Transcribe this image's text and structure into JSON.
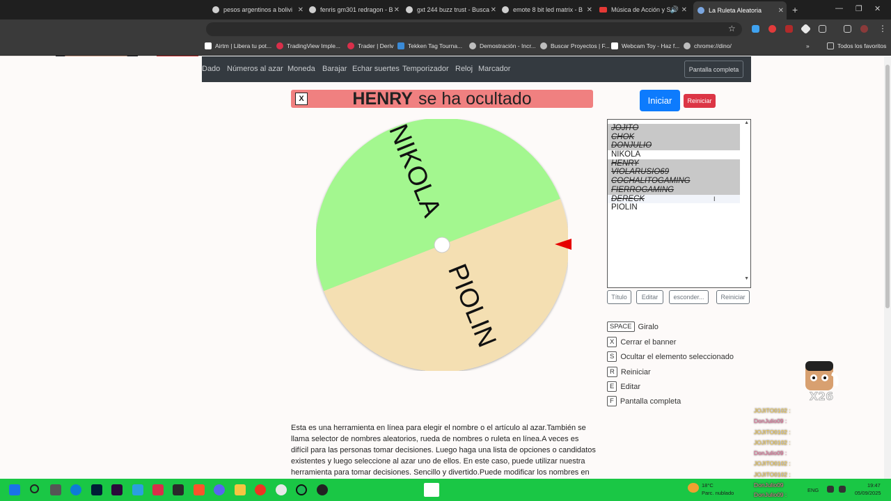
{
  "browser": {
    "tabs": [
      {
        "title": "pesos argentinos a bolivi"
      },
      {
        "title": "fenris gm301 redragon - B"
      },
      {
        "title": "gxt 244 buzz trust - Busca"
      },
      {
        "title": "emote 8 bit led matrix - B"
      },
      {
        "title": "Música de Acción y S"
      },
      {
        "title": "La Ruleta Aleatoria"
      }
    ],
    "new_tab": "+",
    "bookmarks": [
      "Airtm | Libera tu pot...",
      "TradingView Imple...",
      "Trader | Deriv",
      "Tekken Tag Tourna...",
      "Demostración - Incr...",
      "Buscar Proyectos | F...",
      "Webcam Toy - Haz f...",
      "chrome://dino/"
    ],
    "all_bookmarks": "Todos los favoritos"
  },
  "nav": {
    "links": [
      "Dado",
      "Números al azar",
      "Moneda",
      "Barajar",
      "Echar suertes",
      "Temporizador",
      "Reloj",
      "Marcador"
    ],
    "fullscreen": "Pantalla completa"
  },
  "banner": {
    "close": "X",
    "name": "HENRY",
    "message": "se ha ocultado"
  },
  "controls": {
    "start": "Iniciar",
    "reset": "Reiniciar"
  },
  "wheel": {
    "segments": [
      {
        "label": "NIKOLA",
        "color": "#a3f78f"
      },
      {
        "label": "PIOLIN",
        "color": "#f4dfb2"
      }
    ],
    "pointer_color": "#e60000"
  },
  "names_list": [
    {
      "text": "JOJITO",
      "state": "hidden"
    },
    {
      "text": "CHOK",
      "state": "hidden"
    },
    {
      "text": "DONJULIO",
      "state": "hidden"
    },
    {
      "text": "NIKOLA",
      "state": "visible"
    },
    {
      "text": "HENRY",
      "state": "hidden"
    },
    {
      "text": "VIOLARUSIO69",
      "state": "hidden"
    },
    {
      "text": "COCHALITOGAMING",
      "state": "hidden"
    },
    {
      "text": "FIERROGAMING",
      "state": "hidden"
    },
    {
      "text": "DERECK",
      "state": "hover"
    },
    {
      "text": "PIOLIN",
      "state": "visible"
    }
  ],
  "list_buttons": {
    "title": "Título",
    "edit": "Editar",
    "hide": "esconder...",
    "reset": "Reiniciar"
  },
  "shortcuts": [
    {
      "key": "SPACE",
      "label": "Giralo"
    },
    {
      "key": "X",
      "label": "Cerrar el banner"
    },
    {
      "key": "S",
      "label": "Ocultar el elemento seleccionado"
    },
    {
      "key": "R",
      "label": "Reiniciar"
    },
    {
      "key": "E",
      "label": "Editar"
    },
    {
      "key": "F",
      "label": "Pantalla completa"
    }
  ],
  "description": "Esta es una herramienta en línea para elegir el nombre o el artículo al azar.También se llama selector de nombres aleatorios, rueda de nombres o ruleta en línea.A veces es difícil para las personas tomar decisiones. Luego haga una lista de opciones o candidatos existentes y luego seleccione al azar uno de ellos. En este caso, puede utilizar nuestra herramienta para tomar decisiones. Sencillo y divertido.Puede modificar los nombres en textarea, poner un",
  "overlays": {
    "sticker_count": "X26",
    "chat": [
      {
        "text": "JOJITO0102 :",
        "color": "gold"
      },
      {
        "text": "DonJulio09 :",
        "color": "pink"
      },
      {
        "text": "JOJITO0102 :",
        "color": "gold"
      },
      {
        "text": "JOJITO0102 :",
        "color": "gold"
      },
      {
        "text": "DonJulio09 :",
        "color": "pink"
      },
      {
        "text": "JOJITO0102 :",
        "color": "gold"
      },
      {
        "text": "JOJITO0102 :",
        "color": "gold"
      },
      {
        "text": "DonJulio09",
        "color": "pink"
      },
      {
        "text": "DonJulio09 :",
        "color": "pink"
      }
    ]
  },
  "taskbar": {
    "weather_temp": "18°C",
    "weather_desc": "Parc. nublado",
    "language": "ENG",
    "time": "19:47",
    "date": "05/09/2025"
  }
}
